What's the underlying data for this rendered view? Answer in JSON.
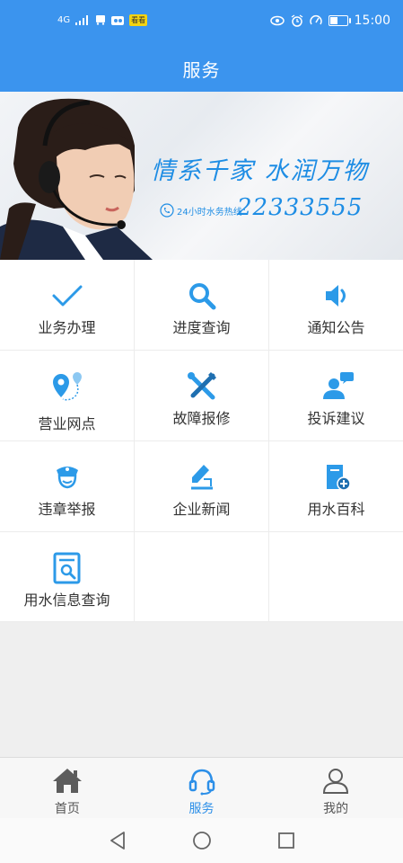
{
  "status_bar": {
    "network": "4G",
    "carrier_badge": "看看",
    "time": "15:00"
  },
  "header": {
    "title": "服务"
  },
  "banner": {
    "slogan": "情系千家 水润万物",
    "hotline_label": "24小时水务热线：",
    "hotline_number": "22333555"
  },
  "services": [
    {
      "label": "业务办理",
      "icon": "check-icon"
    },
    {
      "label": "进度查询",
      "icon": "search-icon"
    },
    {
      "label": "通知公告",
      "icon": "speaker-icon"
    },
    {
      "label": "营业网点",
      "icon": "location-pin-icon"
    },
    {
      "label": "故障报修",
      "icon": "tools-icon"
    },
    {
      "label": "投诉建议",
      "icon": "user-chat-icon"
    },
    {
      "label": "违章举报",
      "icon": "police-officer-icon"
    },
    {
      "label": "企业新闻",
      "icon": "pen-edit-icon"
    },
    {
      "label": "用水百科",
      "icon": "book-plus-icon"
    },
    {
      "label": "用水信息查询",
      "icon": "document-search-icon"
    }
  ],
  "bottom_nav": [
    {
      "label": "首页",
      "icon": "home-icon"
    },
    {
      "label": "服务",
      "icon": "headset-icon",
      "active": true
    },
    {
      "label": "我的",
      "icon": "user-icon"
    }
  ],
  "colors": {
    "primary": "#3b94ee",
    "icon_blue": "#2c9ae8",
    "active_tab": "#2c8fe8"
  }
}
